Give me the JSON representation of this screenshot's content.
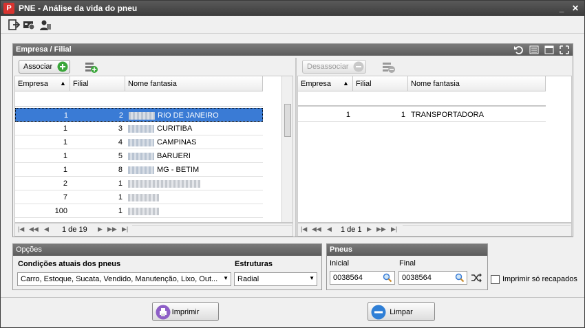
{
  "window": {
    "title": "PNE - Análise da vida do pneu",
    "icon_text": "P"
  },
  "window_controls": {
    "minimize": "_",
    "close": "✕"
  },
  "empresa_panel": {
    "title": "Empresa / Filial",
    "left": {
      "associate_label": "Associar",
      "columns": [
        "Empresa",
        "Filial",
        "Nome fantasia"
      ],
      "sort_indicator": "▲",
      "rows": [
        {
          "empresa": "1",
          "filial": "2",
          "nome": "RIO DE JANEIRO",
          "blurred_prefix": true,
          "selected": true
        },
        {
          "empresa": "1",
          "filial": "3",
          "nome": "CURITIBA",
          "blurred_prefix": true
        },
        {
          "empresa": "1",
          "filial": "4",
          "nome": "CAMPINAS",
          "blurred_prefix": true
        },
        {
          "empresa": "1",
          "filial": "5",
          "nome": "BARUERI",
          "blurred_prefix": true
        },
        {
          "empresa": "1",
          "filial": "8",
          "nome": "MG - BETIM",
          "blurred_prefix": true
        },
        {
          "empresa": "2",
          "filial": "1",
          "nome": "",
          "blurred_prefix": true
        },
        {
          "empresa": "7",
          "filial": "1",
          "nome": "",
          "blurred_prefix": true
        },
        {
          "empresa": "100",
          "filial": "1",
          "nome": "",
          "blurred_prefix": true
        }
      ],
      "pager_text": "1 de 19"
    },
    "right": {
      "disassociate_label": "Desassociar",
      "columns": [
        "Empresa",
        "Filial",
        "Nome fantasia"
      ],
      "sort_indicator": "▲",
      "rows": [
        {
          "empresa": "1",
          "filial": "1",
          "nome": "TRANSPORTADORA"
        }
      ],
      "pager_text": "1 de 1"
    }
  },
  "opcoes": {
    "title": "Opções",
    "condicoes_label": "Condições atuais dos pneus",
    "condicoes_value": "Carro, Estoque, Sucata, Vendido, Manutenção, Lixo, Out...",
    "estruturas_label": "Estruturas",
    "estruturas_value": "Radial"
  },
  "pneus": {
    "title": "Pneus",
    "inicial_label": "Inicial",
    "inicial_value": "0038564",
    "final_label": "Final",
    "final_value": "0038564"
  },
  "recapados_label": "Imprimir só recapados",
  "actions": {
    "print_label": "Imprimir",
    "clear_label": "Limpar"
  },
  "colors": {
    "selection": "#3a7bd5",
    "header_dark": "#5c5c5c",
    "green": "#3aa63a",
    "print_icon": "#8e5fc7",
    "clear_icon": "#2f7fd6"
  }
}
